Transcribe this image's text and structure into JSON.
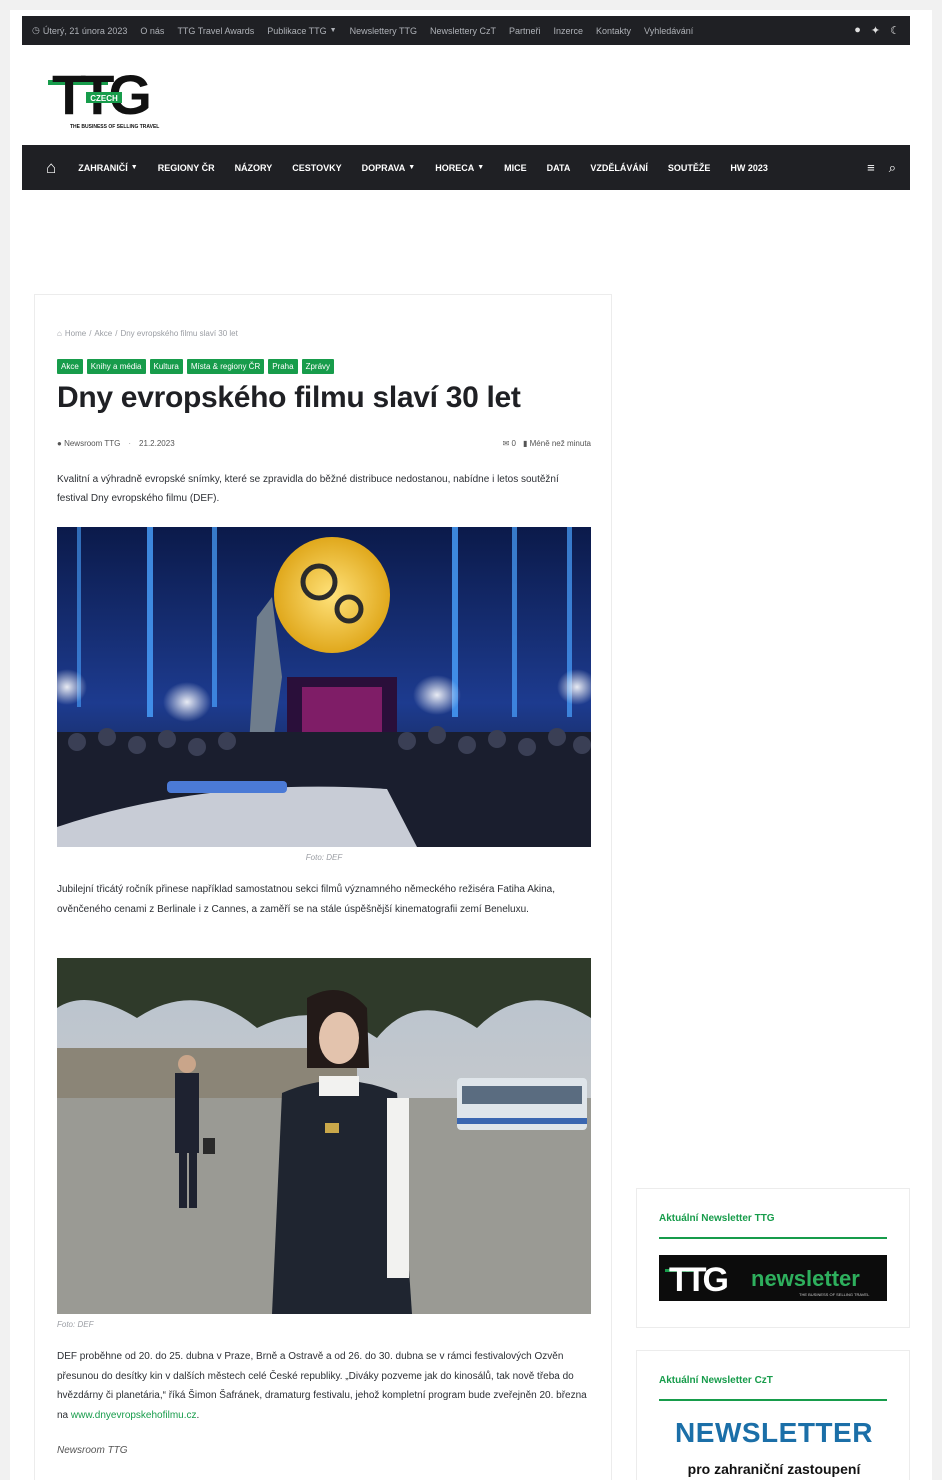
{
  "topbar": {
    "date": "Úterý, 21 února 2023",
    "links": [
      "O nás",
      "TTG Travel Awards",
      "Publikace TTG",
      "Newslettery TTG",
      "Newslettery CzT",
      "Partneři",
      "Inzerce",
      "Kontakty",
      "Vyhledávání"
    ],
    "social_icons": [
      "facebook-icon",
      "twitter-icon",
      "moon-icon"
    ]
  },
  "logo": {
    "text": "TTG",
    "badge": "CZECH",
    "tagline": "THE BUSINESS OF SELLING TRAVEL"
  },
  "nav": {
    "items": [
      "ZAHRANIČÍ",
      "REGIONY ČR",
      "NÁZORY",
      "CESTOVKY",
      "DOPRAVA",
      "HORECA",
      "MICE",
      "DATA",
      "VZDĚLÁVÁNÍ",
      "SOUTĚŽE",
      "HW 2023"
    ]
  },
  "breadcrumb": {
    "home": "Home",
    "sep": "/",
    "cat": "Akce",
    "current": "Dny evropského filmu slaví 30 let"
  },
  "tags": [
    "Akce",
    "Knihy a média",
    "Kultura",
    "Místa & regiony ČR",
    "Praha",
    "Zprávy"
  ],
  "article": {
    "title": "Dny evropského filmu slaví 30 let",
    "author": "Newsroom TTG",
    "date": "21.2.2023",
    "comments": "0",
    "read_time": "Méně než minuta",
    "lead": "Kvalitní a výhradně evropské snímky, které se zpravidla do běžné distribuce nedostanou, nabídne i letos soutěžní festival Dny evropského filmu (DEF).",
    "caption1": "Foto: DEF",
    "para2": "Jubilejní třicátý ročník přinese například samostatnou sekci filmů významného německého režiséra Fatiha Akina, ověnčeného cenami z Berlinale i z Cannes, a zaměří se na stále úspěšnější kinematografii zemí Beneluxu.",
    "caption2": "Foto: DEF",
    "para3": "DEF proběhne od 20. do 25. dubna v Praze, Brně a Ostravě a od 26. do 30. dubna se v rámci festivalových Ozvěn přesunou do desítky kin v dalších městech celé České republiky. „Diváky pozveme jak do kinosálů, tak nově třeba do hvězdárny či planetária,“ říká Šimon Šafránek, dramaturg festivalu, jehož kompletní program bude zveřejněn 20. března na ",
    "link": "www.dnyevropskehofilmu.cz",
    "para3_end": ".",
    "signature": "Newsroom TTG"
  },
  "sidebar": {
    "widget1_title": "Aktuální Newsletter TTG",
    "widget1_banner_logo": "TTG",
    "widget1_banner_text": "newsletter",
    "widget1_banner_tagline": "THE BUSINESS OF SELLING TRAVEL",
    "widget2_title": "Aktuální Newsletter CzT",
    "widget2_heading": "NEWSLETTER",
    "widget2_sub": "pro zahraniční zastoupení"
  },
  "colors": {
    "accent": "#179c4b",
    "dark": "#1f2024",
    "link": "#179c4b",
    "newsletter_blue": "#1b6fa8"
  }
}
